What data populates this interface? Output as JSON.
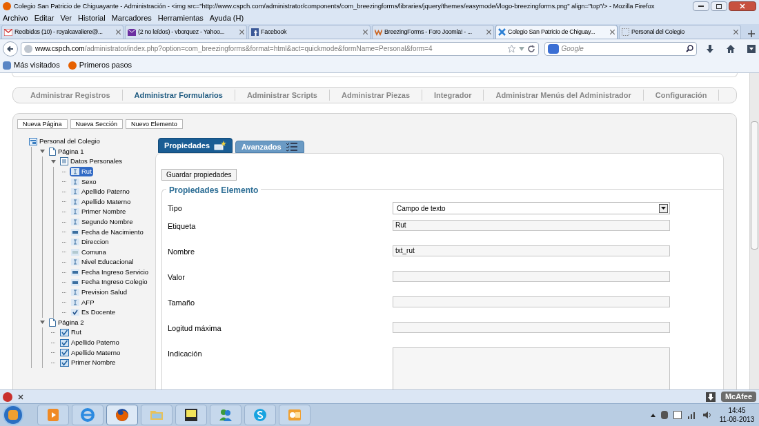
{
  "window": {
    "title": "Colegio San Patricio de Chiguayante - Administración - <img src=\"http://www.cspch.com/administrator/components/com_breezingforms/libraries/jquery/themes/easymode/i/logo-breezingforms.png\" align=\"top\"/> - Mozilla Firefox"
  },
  "menu": [
    "Archivo",
    "Editar",
    "Ver",
    "Historial",
    "Marcadores",
    "Herramientas",
    "Ayuda (H)"
  ],
  "browser_tabs": [
    {
      "label": "Recibidos (10) - royalcavaliere@...",
      "kind": "mail",
      "selected": false
    },
    {
      "label": "(2 no leídos) - vborquez - Yahoo...",
      "kind": "envelope",
      "selected": false
    },
    {
      "label": "Facebook",
      "kind": "facebook",
      "selected": false
    },
    {
      "label": "BreezingForms - Foro Joomla! - ...",
      "kind": "w",
      "selected": false
    },
    {
      "label": "Colegio San Patricio de Chiguay...",
      "kind": "joomla",
      "selected": true
    },
    {
      "label": "Personal del Colegio",
      "kind": "blank",
      "selected": false
    }
  ],
  "address_bar": {
    "domain": "www.cspch.com",
    "path": "/administrator/index.php?option=com_breezingforms&format=html&act=quickmode&formName=Personal&form=4"
  },
  "search": {
    "placeholder": "Google"
  },
  "bookmarks": [
    {
      "label": "Más visitados",
      "kind": "gear"
    },
    {
      "label": "Primeros pasos",
      "kind": "firefox"
    }
  ],
  "admin_nav": [
    {
      "label": "Administrar Registros",
      "selected": false
    },
    {
      "label": "Administrar Formularios",
      "selected": true
    },
    {
      "label": "Administrar Scripts",
      "selected": false
    },
    {
      "label": "Administrar Piezas",
      "selected": false
    },
    {
      "label": "Integrador",
      "selected": false
    },
    {
      "label": "Administrar Menús del Administrador",
      "selected": false
    },
    {
      "label": "Configuración",
      "selected": false
    }
  ],
  "toolbar_buttons": [
    "Nueva Página",
    "Nueva Sección",
    "Nuevo Elemento"
  ],
  "tree": [
    {
      "label": "Personal del Colegio",
      "kind": "form",
      "selected": false,
      "children": [
        {
          "label": "Página 1",
          "kind": "page",
          "selected": false,
          "expanded": true,
          "children": [
            {
              "label": "Datos Personales",
              "kind": "section",
              "selected": false,
              "expanded": true,
              "children": [
                {
                  "label": "Rut",
                  "kind": "text",
                  "selected": true
                },
                {
                  "label": "Sexo",
                  "kind": "text",
                  "selected": false
                },
                {
                  "label": "Apellido Paterno",
                  "kind": "text",
                  "selected": false
                },
                {
                  "label": "Apellido Materno",
                  "kind": "text",
                  "selected": false
                },
                {
                  "label": "Primer Nombre",
                  "kind": "text",
                  "selected": false
                },
                {
                  "label": "Segundo Nombre",
                  "kind": "text",
                  "selected": false
                },
                {
                  "label": "Fecha de Nacimiento",
                  "kind": "date",
                  "selected": false
                },
                {
                  "label": "Direccion",
                  "kind": "text",
                  "selected": false
                },
                {
                  "label": "Comuna",
                  "kind": "select",
                  "selected": false
                },
                {
                  "label": "Nivel Educacional",
                  "kind": "text",
                  "selected": false
                },
                {
                  "label": "Fecha Ingreso Servicio",
                  "kind": "date",
                  "selected": false
                },
                {
                  "label": "Fecha Ingreso Colegio",
                  "kind": "date",
                  "selected": false
                },
                {
                  "label": "Prevision Salud",
                  "kind": "text",
                  "selected": false
                },
                {
                  "label": "AFP",
                  "kind": "text",
                  "selected": false
                },
                {
                  "label": "Es Docente",
                  "kind": "checkbox",
                  "selected": false
                }
              ]
            }
          ]
        },
        {
          "label": "Página 2",
          "kind": "page",
          "selected": false,
          "expanded": true,
          "children": [
            {
              "label": "Rut",
              "kind": "summary",
              "selected": false
            },
            {
              "label": "Apellido Paterno",
              "kind": "summary",
              "selected": false
            },
            {
              "label": "Apellido Materno",
              "kind": "summary",
              "selected": false
            },
            {
              "label": "Primer Nombre",
              "kind": "summary",
              "selected": false
            }
          ]
        }
      ]
    }
  ],
  "panel_tabs": [
    {
      "label": "Propiedades",
      "kind": "properties",
      "selected": true
    },
    {
      "label": "Avanzados",
      "kind": "advanced",
      "selected": false
    }
  ],
  "save_button": "Guardar propiedades",
  "fieldset": {
    "legend": "Propiedades Elemento",
    "fields": [
      {
        "label": "Tipo",
        "kind": "select",
        "value": "Campo de texto"
      },
      {
        "label": "Etiqueta",
        "kind": "text",
        "value": "Rut"
      },
      {
        "label": "Nombre",
        "kind": "text",
        "value": "txt_rut"
      },
      {
        "label": "Valor",
        "kind": "text"
      },
      {
        "label": "Tamaño",
        "kind": "text"
      },
      {
        "label": "Logitud máxima",
        "kind": "text"
      },
      {
        "label": "Indicación",
        "kind": "textarea"
      }
    ]
  },
  "addon_bar": {
    "badge": "McAfee"
  },
  "taskbar": {
    "apps": [
      {
        "kind": "media",
        "selected": false
      },
      {
        "kind": "ie",
        "selected": false
      },
      {
        "kind": "firefox",
        "selected": true
      },
      {
        "kind": "folder",
        "selected": false
      },
      {
        "kind": "notes",
        "selected": false
      },
      {
        "kind": "messenger",
        "selected": false
      },
      {
        "kind": "skype",
        "selected": false
      },
      {
        "kind": "outlook",
        "selected": false
      }
    ],
    "time": "14:45",
    "date": "11-08-2013"
  }
}
